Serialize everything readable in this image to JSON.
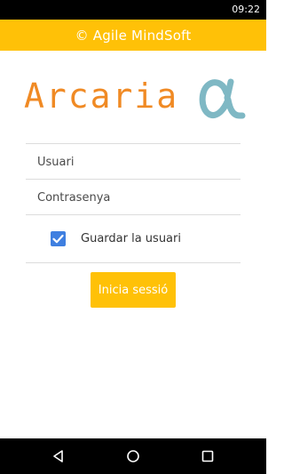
{
  "status_bar": {
    "time": "09:22"
  },
  "header": {
    "title": "© Agile MindSoft",
    "background": "#FFC107"
  },
  "logo": {
    "text": "Arcaria",
    "symbol": "α",
    "text_color": "#F08A24",
    "symbol_color": "#7FB8C4"
  },
  "form": {
    "username_placeholder": "Usuari",
    "password_placeholder": "Contrasenya",
    "remember_label": "Guardar la usuari",
    "remember_checked": true,
    "login_label": "Inicia sessió",
    "accent_color": "#FFC107",
    "checkbox_color": "#3F7FE0"
  },
  "nav_bar": {
    "icons": [
      "back-icon",
      "home-icon",
      "recents-icon"
    ]
  }
}
